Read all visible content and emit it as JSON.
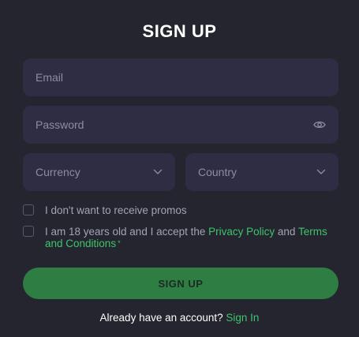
{
  "form": {
    "title": "SIGN UP",
    "email_placeholder": "Email",
    "password_placeholder": "Password",
    "currency_label": "Currency",
    "country_label": "Country",
    "promo_label": "I don't want to receive promos",
    "terms_prefix": "I am 18 years old and I accept the ",
    "privacy_link": "Privacy Policy",
    "terms_and": " and ",
    "terms_link": "Terms and Conditions",
    "required_mark": "*",
    "submit_label": "SIGN UP",
    "footer_text": "Already have an account? ",
    "signin_link": "Sign In"
  },
  "icons": {
    "password_toggle": "eye-icon",
    "currency_dropdown": "chevron-down-icon",
    "country_dropdown": "chevron-down-icon"
  },
  "colors": {
    "background": "#24252e",
    "field": "#2f2d44",
    "accent": "#3ec46d",
    "button": "#2e7d43"
  }
}
